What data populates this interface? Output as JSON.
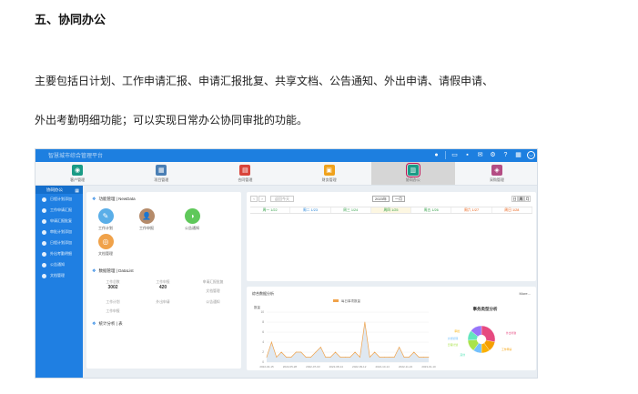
{
  "doc": {
    "heading": "五、协同办公",
    "para1": "主要包括日计划、工作申请汇报、申请汇报批复、共享文档、公告通知、外出申请、请假申请、",
    "para2": "外出考勤明细功能；可以实现日常办公协同审批的功能。"
  },
  "app": {
    "brand": "智慧城市综合管理平台",
    "header_icons": [
      "bell-icon",
      "monitor-icon",
      "chat-icon",
      "mail-icon",
      "settings-icon",
      "help-icon",
      "windows-icon",
      "user-icon"
    ],
    "modules": [
      {
        "label": "客户管理",
        "color": "#1a9b86",
        "glyph": "◉"
      },
      {
        "label": "项目管理",
        "color": "#4a7fb5",
        "glyph": "▦"
      },
      {
        "label": "合同管理",
        "color": "#d9453b",
        "glyph": "▤"
      },
      {
        "label": "财务管理",
        "color": "#f0a21c",
        "glyph": "▣"
      },
      {
        "label": "协同办公",
        "color": "#1a9b86",
        "glyph": "▥",
        "active": true
      },
      {
        "label": "采购管理",
        "color": "#b44d84",
        "glyph": "◈"
      }
    ],
    "sidebar": {
      "title": "协同办公",
      "items": [
        "日程计划添加",
        "工作申请汇报",
        "申请汇报批复",
        "审批计划添加",
        "日程计划添加",
        "外出考勤明细",
        "公告通知",
        "文档管理"
      ]
    },
    "shortcuts": {
      "title": "功能管理 | NewData",
      "items": [
        {
          "label": "工作计划",
          "color": "#5aaee8",
          "glyph": "✎"
        },
        {
          "label": "工作申报",
          "color": "#b58b6a",
          "glyph": "👤"
        },
        {
          "label": "公告通知",
          "color": "#5fc85a",
          "glyph": "◑"
        },
        {
          "label": "文档管理",
          "color": "#f0a24a",
          "glyph": "◎"
        }
      ]
    },
    "stats": {
      "title": "数据管理 | DataList",
      "items": [
        {
          "label": "工作总数",
          "value": "3002"
        },
        {
          "label": "工作申报",
          "value": "420"
        },
        {
          "label": "申请汇报批复",
          "value": ""
        },
        {
          "label": "工作计划",
          "value": ""
        },
        {
          "label": "外出申请",
          "value": ""
        },
        {
          "label": "公告通知",
          "value": ""
        },
        {
          "label": "工作申报",
          "value": ""
        },
        {
          "label": "文档管理",
          "value": ""
        }
      ],
      "footer": "统计分析 | 表"
    },
    "calendar": {
      "today_label": "返回今天",
      "year": "2023年",
      "month": "一月",
      "views": [
        "日",
        "周",
        "月"
      ],
      "days": [
        {
          "label": "周一 1/22",
          "color": "#2f9e44",
          "today": false
        },
        {
          "label": "周二 1/23",
          "color": "#1c7ed6",
          "today": false
        },
        {
          "label": "周三 1/24",
          "color": "#2f9e44",
          "today": false
        },
        {
          "label": "周四 1/25",
          "color": "#2f9e44",
          "today": true
        },
        {
          "label": "周五 1/26",
          "color": "#2f9e44",
          "today": false
        },
        {
          "label": "周六 1/27",
          "color": "#e8590c",
          "today": false
        },
        {
          "label": "周日 1/28",
          "color": "#e8590c",
          "today": false
        }
      ]
    },
    "chart_panel": {
      "title": "综合数据分析",
      "more": "More..."
    }
  },
  "chart_data": [
    {
      "type": "area",
      "series": [
        {
          "name": "每日事项数量",
          "values": [
            1,
            4,
            1,
            2,
            1,
            1,
            2,
            2,
            1,
            1,
            2,
            3,
            1,
            1,
            2,
            1,
            1,
            1,
            2,
            1,
            8,
            1,
            2,
            1,
            1,
            1,
            1,
            3,
            1,
            1,
            2,
            1,
            1,
            1
          ]
        }
      ],
      "ylabel": "数量",
      "ylim": [
        0,
        10
      ],
      "yticks": [
        0,
        2,
        4,
        6,
        8,
        10
      ],
      "xtick_labels": [
        "2022-04-15",
        "2022-05-28",
        "2022-07-03",
        "2022-08-14",
        "2022-09-12",
        "2022-10-14",
        "2022-11-22",
        "2023-01-10"
      ],
      "color": "#f0a24a"
    },
    {
      "type": "pie",
      "title": "事务类型分析",
      "slices": [
        {
          "label": "外出考勤",
          "value": 28,
          "color": "#e64980"
        },
        {
          "label": "工作申请",
          "value": 12,
          "color": "#f59f00"
        },
        {
          "label": "公告通知",
          "value": 10,
          "color": "#fab005"
        },
        {
          "label": "文档管理",
          "value": 10,
          "color": "#74c0fc"
        },
        {
          "label": "日程计划",
          "value": 14,
          "color": "#a9e34b"
        },
        {
          "label": "审批",
          "value": 12,
          "color": "#63e6be"
        },
        {
          "label": "其他",
          "value": 14,
          "color": "#9775fa"
        }
      ],
      "callouts": [
        "外出考勤",
        "工作申请",
        "审批",
        "文档管理",
        "日程计划",
        "其他"
      ]
    }
  ]
}
